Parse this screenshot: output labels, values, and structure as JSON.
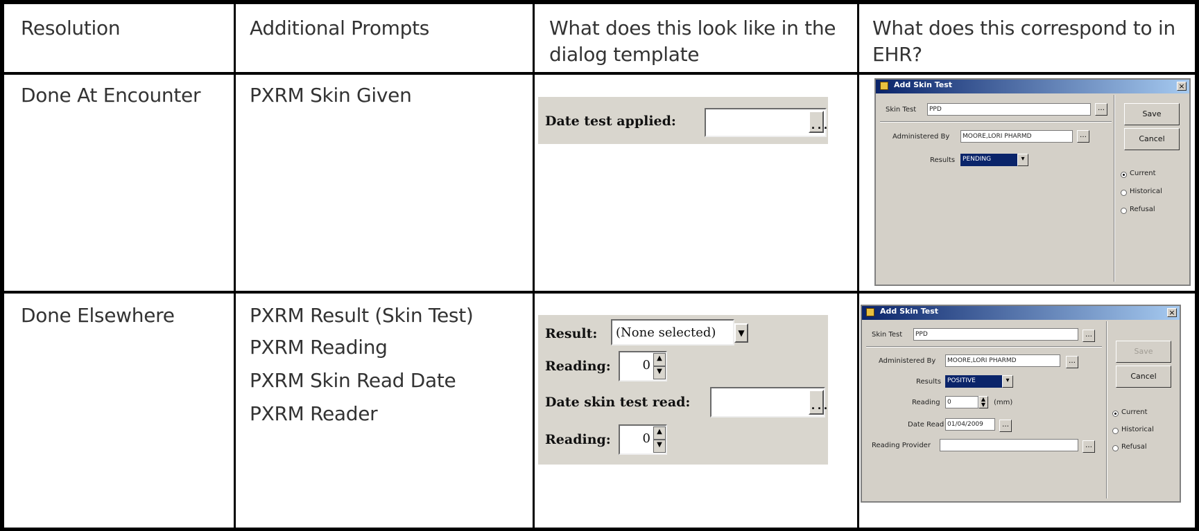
{
  "headers": {
    "resolution": "Resolution",
    "additional_prompts": "Additional Prompts",
    "dialog_template_line1": "What does this look like in the",
    "dialog_template_line2": "dialog template",
    "ehr_line1": "What does this correspond to in",
    "ehr_line2": "EHR?"
  },
  "rows": [
    {
      "resolution": "Done At Encounter",
      "prompts": [
        "PXRM Skin Given"
      ],
      "template": {
        "date_label": "Date test applied:",
        "browse_glyph": "..."
      },
      "ehr": {
        "title": "Add Skin Test",
        "skin_test_label": "Skin Test",
        "skin_test_value": "PPD",
        "administered_label": "Administered By",
        "administered_value": "MOORE,LORI PHARMD",
        "results_label": "Results",
        "results_value": "PENDING",
        "save": "Save",
        "cancel": "Cancel",
        "radio_current": "Current",
        "radio_historical": "Historical",
        "radio_refusal": "Refusal"
      }
    },
    {
      "resolution": "Done Elsewhere",
      "prompts": [
        "PXRM Result (Skin Test)",
        "PXRM Reading",
        "PXRM Skin Read Date",
        "PXRM Reader"
      ],
      "template": {
        "result_label": "Result:",
        "result_value": "(None selected)",
        "reading_label": "Reading:",
        "reading_value": "0",
        "date_read_label": "Date skin test read:",
        "reading2_label": "Reading:",
        "reading2_value": "0",
        "browse_glyph": "..."
      },
      "ehr": {
        "title": "Add Skin Test",
        "skin_test_label": "Skin Test",
        "skin_test_value": "PPD",
        "administered_label": "Administered By",
        "administered_value": "MOORE,LORI PHARMD",
        "results_label": "Results",
        "results_value": "POSITIVE",
        "reading_label": "Reading",
        "reading_value": "0",
        "reading_unit": "(mm)",
        "date_read_label": "Date Read",
        "date_read_value": "01/04/2009",
        "reading_provider_label": "Reading Provider",
        "save": "Save",
        "cancel": "Cancel",
        "radio_current": "Current",
        "radio_historical": "Historical",
        "radio_refusal": "Refusal"
      }
    }
  ]
}
